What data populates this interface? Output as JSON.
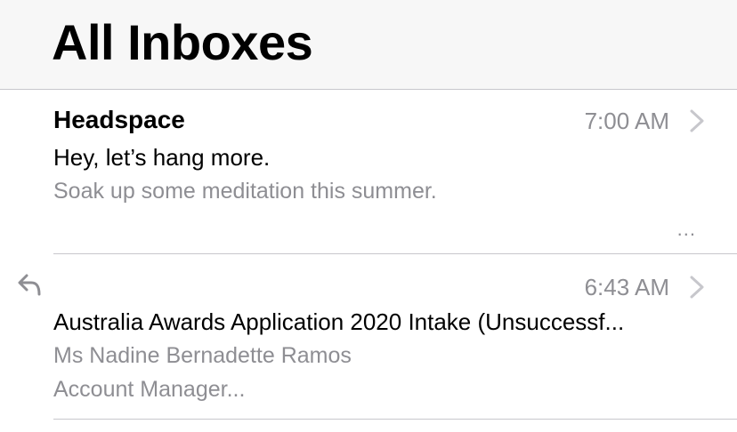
{
  "header": {
    "title": "All Inboxes"
  },
  "messages": [
    {
      "sender": "Headspace",
      "time": "7:00 AM",
      "subject": " Hey, let’s hang more.",
      "preview": "Soak up some meditation this summer.",
      "more": "...",
      "chevron_icon": "chevron-right-icon"
    },
    {
      "sender": "",
      "time": "6:43 AM",
      "subject": "Australia Awards Application 2020 Intake (Unsuccessf...",
      "preview_line1": "Ms Nadine Bernadette Ramos",
      "preview_line2": "Account Manager...",
      "status_icon": "replied-arrow-icon",
      "chevron_icon": "chevron-right-icon"
    }
  ],
  "colors": {
    "header_bg": "#f7f7f7",
    "secondary_text": "#8e8e93",
    "separator": "#c8c7cc",
    "chevron": "#c7c7cc"
  }
}
